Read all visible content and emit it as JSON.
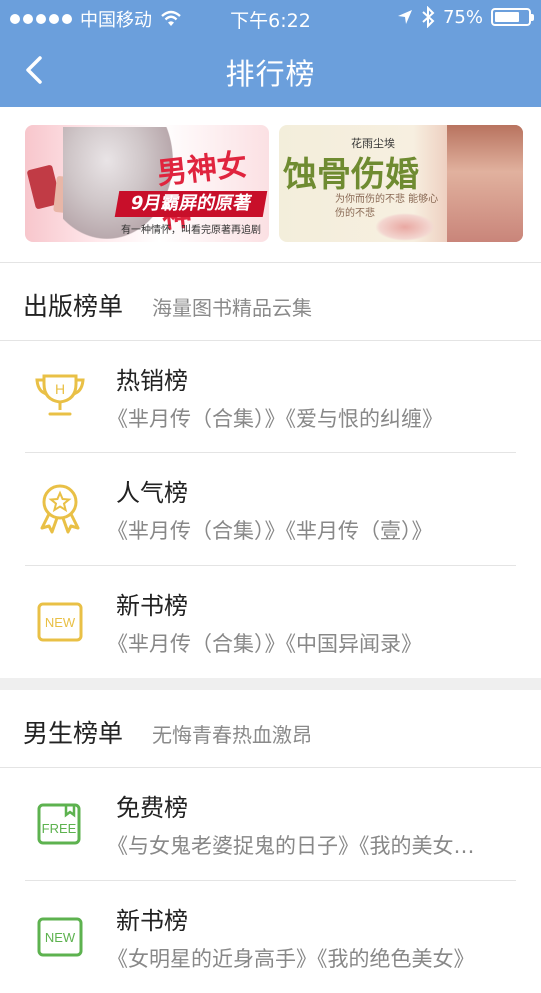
{
  "status_bar": {
    "carrier": "中国移动",
    "time": "下午6:22",
    "battery": "75%",
    "battery_level": 0.75
  },
  "nav": {
    "title": "排行榜",
    "back_icon": "chevron-left-icon"
  },
  "banners": [
    {
      "title": "男神女神",
      "ribbon": "9月霸屏的原著",
      "caption": "有一种情怀，叫看完原著再追剧"
    },
    {
      "author": "花雨尘埃",
      "title": "蚀骨伤婚",
      "subtitle": "为你而伤的不悲 能够心伤的不悲"
    }
  ],
  "sections": [
    {
      "name": "出版榜单",
      "desc": "海量图书精品云集",
      "accent": "#e9c046",
      "rows": [
        {
          "icon": "trophy-icon",
          "title": "热销榜",
          "books": "《芈月传（合集）》《爱与恨的纠缠》"
        },
        {
          "icon": "medal-icon",
          "title": "人气榜",
          "books": "《芈月传（合集）》《芈月传（壹）》"
        },
        {
          "icon": "new-badge-icon",
          "title": "新书榜",
          "books": "《芈月传（合集）》《中国异闻录》"
        }
      ]
    },
    {
      "name": "男生榜单",
      "desc": "无悔青春热血激昂",
      "accent": "#5db24f",
      "rows": [
        {
          "icon": "free-badge-icon",
          "title": "免费榜",
          "books": "《与女鬼老婆捉鬼的日子》《我的美女总裁》"
        },
        {
          "icon": "new-badge-icon",
          "title": "新书榜",
          "books": "《女明星的近身高手》《我的绝色美女》"
        }
      ]
    }
  ]
}
